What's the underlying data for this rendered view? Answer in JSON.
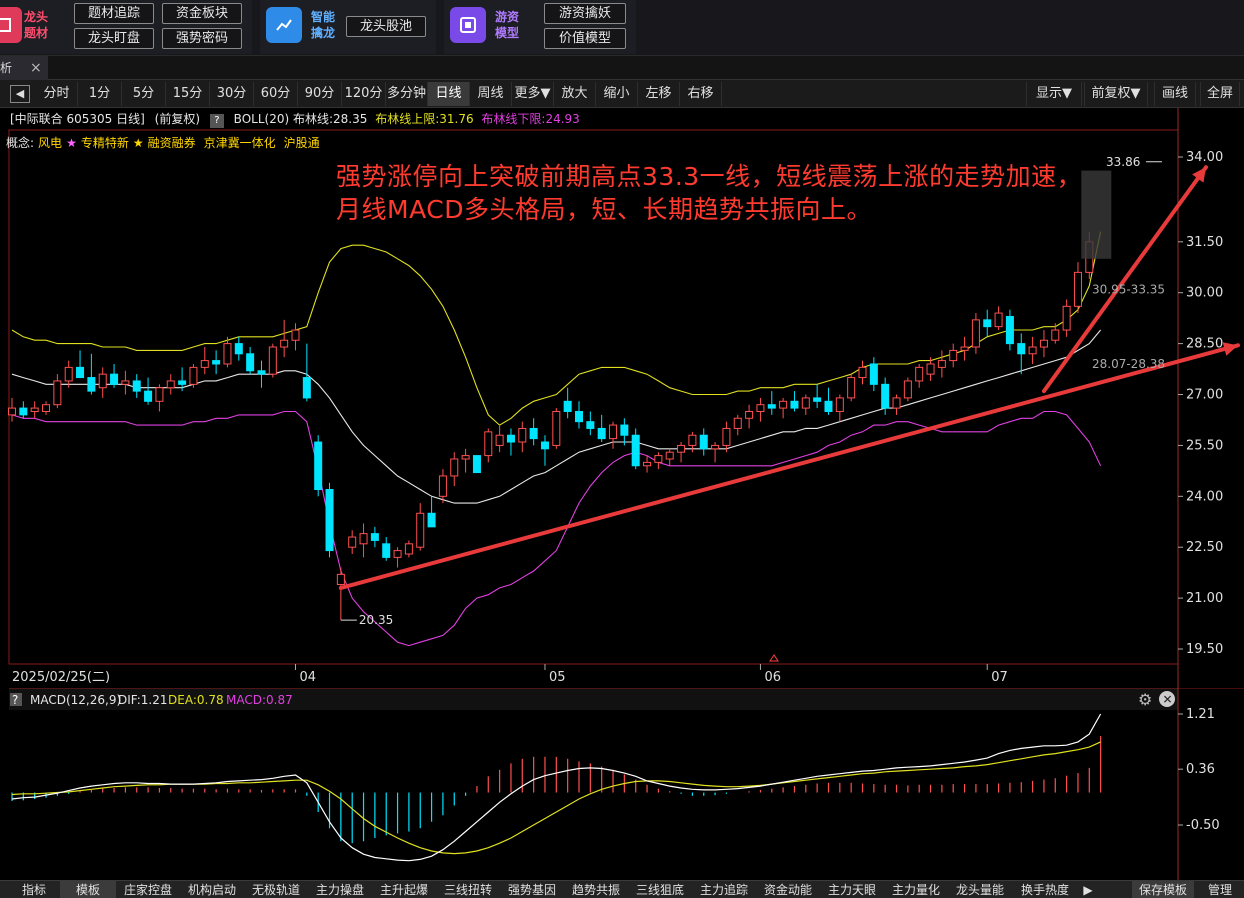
{
  "top_groups": [
    {
      "title": "龙头题材",
      "buttons": [
        "题材追踪",
        "资金板块",
        "龙头盯盘",
        "强势密码"
      ]
    },
    {
      "title": "智能擒龙",
      "buttons": [
        "龙头股池"
      ]
    },
    {
      "title": "游资模型",
      "buttons": [
        "游资擒妖",
        "价值模型"
      ]
    }
  ],
  "tab": {
    "label": "析",
    "close": "×"
  },
  "periods": [
    "分时",
    "1分",
    "5分",
    "15分",
    "30分",
    "60分",
    "90分",
    "120分",
    "多分钟",
    "日线",
    "周线",
    "更多▼",
    "放大",
    "缩小",
    "左移",
    "右移"
  ],
  "active_period": "日线",
  "right_tools": [
    "显示▼",
    "前复权▼",
    "画线",
    "全屏"
  ],
  "info": {
    "stock": "[中际联合 605305 日线]",
    "adjust": "(前复权)",
    "help": "?",
    "boll": "BOLL(20) 布林线:28.35",
    "upper": "布林线上限:31.76",
    "lower": "布林线下限:24.93"
  },
  "concepts": {
    "label": "概念:",
    "items": [
      {
        "text": "风电",
        "star": "★",
        "color": "#ffd700",
        "star_color": "#ff66ff"
      },
      {
        "text": "专精特新",
        "star": "★",
        "color": "#ffd700",
        "star_color": "#ffd700"
      },
      {
        "text": "融资融券",
        "star": "",
        "color": "#ffd700",
        "star_color": ""
      },
      {
        "text": "京津冀一体化",
        "star": "",
        "color": "#ffd700",
        "star_color": ""
      },
      {
        "text": "沪股通",
        "star": "",
        "color": "#ffd700",
        "star_color": ""
      }
    ]
  },
  "annotation": "强势涨停向上突破前期高点33.3一线，短线震荡上涨的走势加速，月线MACD多头格局，短、长期趋势共振向上。",
  "chart_data": {
    "type": "candlestick",
    "y_axis_ticks": [
      "34.00",
      "31.50",
      "30.00",
      "28.50",
      "27.00",
      "25.50",
      "24.00",
      "22.50",
      "21.00",
      "19.50"
    ],
    "x_axis_labels": [
      {
        "label": "2025/02/25(二)",
        "index": 0
      },
      {
        "label": "04",
        "index": 25
      },
      {
        "label": "05",
        "index": 47
      },
      {
        "label": "06",
        "index": 66
      },
      {
        "label": "07",
        "index": 86
      }
    ],
    "ohlc": [
      [
        26.4,
        26.9,
        26.2,
        26.6
      ],
      [
        26.6,
        26.8,
        26.3,
        26.4
      ],
      [
        26.5,
        26.8,
        26.3,
        26.6
      ],
      [
        26.5,
        26.8,
        26.4,
        26.7
      ],
      [
        26.7,
        27.6,
        26.6,
        27.4
      ],
      [
        27.4,
        28.0,
        27.2,
        27.8
      ],
      [
        27.8,
        28.3,
        27.5,
        27.5
      ],
      [
        27.5,
        28.2,
        27.0,
        27.1
      ],
      [
        27.2,
        27.8,
        26.9,
        27.6
      ],
      [
        27.6,
        27.9,
        27.2,
        27.3
      ],
      [
        27.3,
        27.7,
        27.0,
        27.4
      ],
      [
        27.4,
        27.6,
        26.9,
        27.1
      ],
      [
        27.1,
        27.5,
        26.7,
        26.8
      ],
      [
        26.8,
        27.3,
        26.5,
        27.2
      ],
      [
        27.2,
        27.6,
        27.0,
        27.4
      ],
      [
        27.4,
        27.8,
        27.1,
        27.3
      ],
      [
        27.3,
        27.9,
        27.2,
        27.8
      ],
      [
        27.8,
        28.4,
        27.6,
        28.0
      ],
      [
        28.0,
        28.3,
        27.6,
        27.9
      ],
      [
        27.9,
        28.7,
        27.8,
        28.5
      ],
      [
        28.5,
        28.7,
        28.0,
        28.2
      ],
      [
        28.2,
        28.4,
        27.6,
        27.7
      ],
      [
        27.7,
        28.0,
        27.2,
        27.6
      ],
      [
        27.6,
        28.5,
        27.5,
        28.4
      ],
      [
        28.4,
        29.2,
        28.1,
        28.6
      ],
      [
        28.6,
        29.1,
        28.3,
        28.9
      ],
      [
        27.5,
        28.5,
        26.8,
        26.9
      ],
      [
        25.6,
        25.8,
        24.0,
        24.2
      ],
      [
        24.2,
        24.4,
        22.2,
        22.4
      ],
      [
        21.4,
        21.9,
        20.35,
        21.7
      ],
      [
        22.5,
        23.0,
        22.3,
        22.8
      ],
      [
        22.6,
        23.2,
        22.2,
        22.9
      ],
      [
        22.9,
        23.1,
        22.5,
        22.7
      ],
      [
        22.6,
        22.8,
        22.1,
        22.2
      ],
      [
        22.2,
        22.5,
        21.9,
        22.4
      ],
      [
        22.3,
        22.7,
        22.2,
        22.6
      ],
      [
        22.5,
        23.8,
        22.4,
        23.5
      ],
      [
        23.5,
        24.0,
        23.2,
        23.1
      ],
      [
        24.0,
        24.8,
        23.8,
        24.6
      ],
      [
        24.6,
        25.3,
        24.3,
        25.1
      ],
      [
        25.1,
        25.4,
        24.7,
        25.2
      ],
      [
        25.2,
        25.2,
        24.8,
        24.7
      ],
      [
        25.2,
        26.0,
        25.0,
        25.9
      ],
      [
        25.5,
        26.1,
        25.3,
        25.8
      ],
      [
        25.8,
        26.0,
        25.2,
        25.6
      ],
      [
        25.6,
        26.2,
        25.3,
        26.0
      ],
      [
        26.0,
        26.3,
        25.5,
        25.7
      ],
      [
        25.6,
        25.8,
        24.9,
        25.4
      ],
      [
        25.5,
        26.6,
        25.4,
        26.5
      ],
      [
        26.8,
        27.2,
        26.3,
        26.5
      ],
      [
        26.5,
        26.8,
        26.0,
        26.2
      ],
      [
        26.2,
        26.5,
        25.8,
        26.0
      ],
      [
        26.0,
        26.4,
        25.6,
        25.7
      ],
      [
        25.7,
        26.2,
        25.4,
        26.1
      ],
      [
        26.1,
        26.3,
        25.5,
        25.8
      ],
      [
        25.8,
        26.0,
        24.8,
        24.9
      ],
      [
        24.9,
        25.2,
        24.7,
        25.0
      ],
      [
        25.0,
        25.3,
        24.8,
        25.2
      ],
      [
        25.1,
        25.4,
        24.9,
        25.3
      ],
      [
        25.3,
        25.6,
        25.0,
        25.5
      ],
      [
        25.5,
        25.9,
        25.3,
        25.8
      ],
      [
        25.8,
        26.0,
        25.2,
        25.4
      ],
      [
        25.4,
        25.6,
        25.0,
        25.5
      ],
      [
        25.5,
        26.2,
        25.3,
        26.0
      ],
      [
        26.0,
        26.4,
        25.8,
        26.3
      ],
      [
        26.3,
        26.7,
        26.0,
        26.5
      ],
      [
        26.5,
        26.9,
        26.2,
        26.7
      ],
      [
        26.7,
        27.1,
        26.4,
        26.6
      ],
      [
        26.6,
        26.9,
        26.3,
        26.8
      ],
      [
        26.8,
        27.1,
        26.5,
        26.6
      ],
      [
        26.6,
        27.0,
        26.4,
        26.9
      ],
      [
        26.9,
        27.3,
        26.6,
        26.8
      ],
      [
        26.8,
        27.2,
        26.4,
        26.5
      ],
      [
        26.5,
        27.0,
        26.2,
        26.9
      ],
      [
        26.9,
        27.6,
        26.8,
        27.5
      ],
      [
        27.5,
        28.0,
        27.3,
        27.8
      ],
      [
        27.9,
        28.1,
        27.1,
        27.3
      ],
      [
        27.3,
        27.5,
        26.4,
        26.6
      ],
      [
        26.6,
        27.0,
        26.4,
        26.9
      ],
      [
        26.9,
        27.5,
        26.8,
        27.4
      ],
      [
        27.4,
        27.9,
        27.2,
        27.8
      ],
      [
        27.6,
        28.1,
        27.4,
        27.9
      ],
      [
        27.8,
        28.3,
        27.5,
        28.0
      ],
      [
        28.0,
        28.5,
        27.8,
        28.3
      ],
      [
        28.3,
        28.7,
        28.0,
        28.4
      ],
      [
        28.4,
        29.4,
        28.2,
        29.2
      ],
      [
        29.2,
        29.5,
        28.7,
        29.0
      ],
      [
        29.0,
        29.6,
        28.9,
        29.4
      ],
      [
        29.3,
        29.5,
        28.3,
        28.5
      ],
      [
        28.5,
        28.8,
        27.6,
        28.2
      ],
      [
        28.2,
        28.7,
        27.9,
        28.4
      ],
      [
        28.4,
        28.9,
        28.1,
        28.6
      ],
      [
        28.6,
        29.1,
        28.5,
        28.9
      ],
      [
        28.9,
        29.8,
        28.7,
        29.6
      ],
      [
        29.6,
        30.9,
        29.4,
        30.6
      ],
      [
        30.6,
        31.8,
        30.4,
        31.5
      ]
    ],
    "boll_upper": [
      28.9,
      28.7,
      28.6,
      28.6,
      28.5,
      28.5,
      28.5,
      28.5,
      28.4,
      28.4,
      28.4,
      28.3,
      28.3,
      28.3,
      28.3,
      28.3,
      28.4,
      28.5,
      28.5,
      28.6,
      28.7,
      28.7,
      28.7,
      28.7,
      28.8,
      28.9,
      29.0,
      30.0,
      30.9,
      31.3,
      31.4,
      31.4,
      31.3,
      31.2,
      31.0,
      30.8,
      30.5,
      30.1,
      29.6,
      28.9,
      28.1,
      27.2,
      26.4,
      26.1,
      26.3,
      26.6,
      26.8,
      26.9,
      27.0,
      27.3,
      27.6,
      27.7,
      27.8,
      27.8,
      27.8,
      27.7,
      27.6,
      27.4,
      27.2,
      27.1,
      27.0,
      27.0,
      27.0,
      27.0,
      27.1,
      27.1,
      27.2,
      27.2,
      27.2,
      27.3,
      27.3,
      27.3,
      27.4,
      27.5,
      27.6,
      27.8,
      27.9,
      27.9,
      27.9,
      27.9,
      28.0,
      28.0,
      28.1,
      28.2,
      28.3,
      28.5,
      28.7,
      28.8,
      28.9,
      28.9,
      28.9,
      29.0,
      29.0,
      29.2,
      29.5,
      30.2,
      31.8
    ],
    "boll_mid": [
      27.6,
      27.5,
      27.4,
      27.3,
      27.3,
      27.3,
      27.3,
      27.3,
      27.3,
      27.3,
      27.3,
      27.2,
      27.2,
      27.2,
      27.2,
      27.2,
      27.3,
      27.4,
      27.4,
      27.5,
      27.6,
      27.6,
      27.6,
      27.6,
      27.7,
      27.7,
      27.6,
      27.3,
      26.9,
      26.4,
      25.9,
      25.5,
      25.2,
      24.9,
      24.6,
      24.4,
      24.2,
      24.0,
      23.9,
      23.8,
      23.8,
      23.8,
      23.9,
      24.0,
      24.2,
      24.4,
      24.6,
      24.7,
      24.9,
      25.1,
      25.3,
      25.4,
      25.5,
      25.6,
      25.6,
      25.6,
      25.5,
      25.4,
      25.4,
      25.4,
      25.4,
      25.4,
      25.4,
      25.4,
      25.5,
      25.6,
      25.7,
      25.8,
      25.9,
      25.9,
      26.0,
      26.0,
      26.1,
      26.2,
      26.3,
      26.4,
      26.5,
      26.6,
      26.6,
      26.7,
      26.8,
      26.9,
      27.0,
      27.1,
      27.2,
      27.3,
      27.4,
      27.5,
      27.6,
      27.7,
      27.8,
      27.9,
      28.0,
      28.1,
      28.3,
      28.5,
      28.9
    ],
    "boll_lower": [
      26.4,
      26.3,
      26.3,
      26.2,
      26.2,
      26.2,
      26.2,
      26.2,
      26.2,
      26.2,
      26.2,
      26.1,
      26.1,
      26.1,
      26.1,
      26.1,
      26.2,
      26.2,
      26.3,
      26.3,
      26.4,
      26.4,
      26.4,
      26.4,
      26.5,
      26.5,
      26.2,
      24.8,
      23.2,
      21.8,
      21.0,
      20.6,
      20.3,
      20.0,
      19.7,
      19.6,
      19.7,
      19.8,
      19.9,
      20.2,
      20.7,
      21.0,
      21.1,
      21.3,
      21.4,
      21.6,
      21.8,
      22.1,
      22.4,
      23.1,
      23.8,
      24.3,
      24.7,
      25.0,
      25.2,
      25.3,
      25.2,
      25.0,
      24.9,
      24.9,
      24.9,
      24.9,
      24.9,
      24.9,
      24.9,
      24.9,
      24.9,
      24.9,
      25.0,
      25.1,
      25.2,
      25.3,
      25.5,
      25.6,
      25.8,
      25.9,
      26.1,
      26.1,
      26.2,
      26.2,
      26.1,
      26.0,
      25.9,
      25.9,
      25.9,
      25.9,
      25.9,
      26.1,
      26.2,
      26.3,
      26.3,
      26.5,
      26.5,
      26.4,
      26.0,
      25.6,
      24.9
    ],
    "annotations": [
      {
        "text": "33.86",
        "at_index": 96,
        "value": 33.86
      },
      {
        "text": "20.35",
        "at_index": 29,
        "value": 20.35
      },
      {
        "text": "30.95-33.35",
        "at_index": 93,
        "value": 30.1
      },
      {
        "text": "28.07-28.38",
        "at_index": 91,
        "value": 27.9
      }
    ],
    "trendlines": [
      {
        "from": [
          29,
          21.3
        ],
        "to": [
          100,
          28.5
        ]
      },
      {
        "from": [
          91,
          27.1
        ],
        "to": [
          96,
          34.0
        ]
      }
    ],
    "macd": {
      "title": "MACD(12,26,9)",
      "dif_label": "DIF:1.21",
      "dea_label": "DEA:0.78",
      "macd_label": "MACD:0.87",
      "y_ticks": [
        "1.21",
        "0.36",
        "-0.50"
      ],
      "hist": [
        -0.13,
        -0.12,
        -0.1,
        -0.08,
        -0.05,
        -0.02,
        0.02,
        0.04,
        0.06,
        0.07,
        0.08,
        0.08,
        0.08,
        0.07,
        0.07,
        0.06,
        0.06,
        0.06,
        0.05,
        0.06,
        0.05,
        0.05,
        0.04,
        0.05,
        0.05,
        0.05,
        -0.05,
        -0.3,
        -0.55,
        -0.75,
        -0.78,
        -0.75,
        -0.7,
        -0.66,
        -0.63,
        -0.6,
        -0.55,
        -0.45,
        -0.35,
        -0.2,
        -0.05,
        0.1,
        0.25,
        0.35,
        0.45,
        0.52,
        0.55,
        0.55,
        0.55,
        0.52,
        0.48,
        0.45,
        0.4,
        0.35,
        0.28,
        0.2,
        0.12,
        0.06,
        0.02,
        -0.02,
        -0.05,
        -0.05,
        -0.04,
        -0.02,
        0.0,
        0.02,
        0.04,
        0.06,
        0.08,
        0.1,
        0.12,
        0.14,
        0.15,
        0.15,
        0.15,
        0.14,
        0.13,
        0.12,
        0.12,
        0.11,
        0.12,
        0.12,
        0.12,
        0.13,
        0.13,
        0.13,
        0.13,
        0.14,
        0.15,
        0.16,
        0.18,
        0.2,
        0.22,
        0.26,
        0.3,
        0.38,
        0.87
      ],
      "dif": [
        -0.1,
        -0.08,
        -0.07,
        -0.04,
        -0.01,
        0.03,
        0.07,
        0.1,
        0.12,
        0.14,
        0.15,
        0.15,
        0.14,
        0.14,
        0.13,
        0.13,
        0.13,
        0.14,
        0.15,
        0.17,
        0.18,
        0.19,
        0.2,
        0.22,
        0.25,
        0.27,
        0.15,
        -0.15,
        -0.45,
        -0.7,
        -0.85,
        -0.95,
        -1.0,
        -1.02,
        -1.04,
        -1.05,
        -1.03,
        -0.98,
        -0.88,
        -0.75,
        -0.6,
        -0.45,
        -0.3,
        -0.15,
        -0.02,
        0.1,
        0.2,
        0.26,
        0.3,
        0.34,
        0.37,
        0.38,
        0.37,
        0.34,
        0.3,
        0.25,
        0.18,
        0.14,
        0.1,
        0.07,
        0.05,
        0.04,
        0.04,
        0.05,
        0.06,
        0.08,
        0.1,
        0.13,
        0.16,
        0.19,
        0.22,
        0.25,
        0.27,
        0.29,
        0.31,
        0.33,
        0.34,
        0.36,
        0.38,
        0.39,
        0.4,
        0.41,
        0.43,
        0.45,
        0.47,
        0.5,
        0.53,
        0.6,
        0.65,
        0.68,
        0.7,
        0.72,
        0.72,
        0.73,
        0.78,
        0.9,
        1.21
      ],
      "dea": [
        -0.03,
        -0.02,
        -0.02,
        -0.01,
        0.0,
        0.01,
        0.03,
        0.05,
        0.07,
        0.09,
        0.1,
        0.11,
        0.12,
        0.12,
        0.13,
        0.13,
        0.13,
        0.13,
        0.14,
        0.14,
        0.15,
        0.15,
        0.16,
        0.17,
        0.18,
        0.19,
        0.19,
        0.12,
        0.02,
        -0.1,
        -0.25,
        -0.4,
        -0.52,
        -0.61,
        -0.7,
        -0.78,
        -0.85,
        -0.9,
        -0.93,
        -0.94,
        -0.93,
        -0.9,
        -0.85,
        -0.78,
        -0.7,
        -0.6,
        -0.5,
        -0.4,
        -0.3,
        -0.2,
        -0.1,
        -0.02,
        0.05,
        0.1,
        0.14,
        0.17,
        0.18,
        0.18,
        0.17,
        0.15,
        0.13,
        0.11,
        0.1,
        0.09,
        0.09,
        0.1,
        0.11,
        0.13,
        0.15,
        0.17,
        0.19,
        0.21,
        0.23,
        0.25,
        0.27,
        0.29,
        0.3,
        0.32,
        0.33,
        0.34,
        0.35,
        0.36,
        0.37,
        0.38,
        0.4,
        0.41,
        0.43,
        0.46,
        0.49,
        0.52,
        0.55,
        0.58,
        0.6,
        0.63,
        0.66,
        0.7,
        0.78
      ]
    }
  },
  "bottom_tabs": [
    "指标",
    "模板",
    "庄家控盘",
    "机构启动",
    "无极轨道",
    "主力操盘",
    "主升起爆",
    "三线扭转",
    "强势基因",
    "趋势共振",
    "三线狙底",
    "主力追踪",
    "资金动能",
    "主力天眼",
    "主力量化",
    "龙头量能",
    "换手热度",
    "▶"
  ],
  "bottom_right": [
    "保存模板",
    "管理"
  ],
  "colors": {
    "up": "#ff5050",
    "down": "#00e5ff",
    "boll_upper": "#e0e020",
    "boll_mid": "#e8e8e8",
    "boll_lower": "#e040e0",
    "trend": "#e83a3a",
    "annotation": "#ff3b30"
  }
}
